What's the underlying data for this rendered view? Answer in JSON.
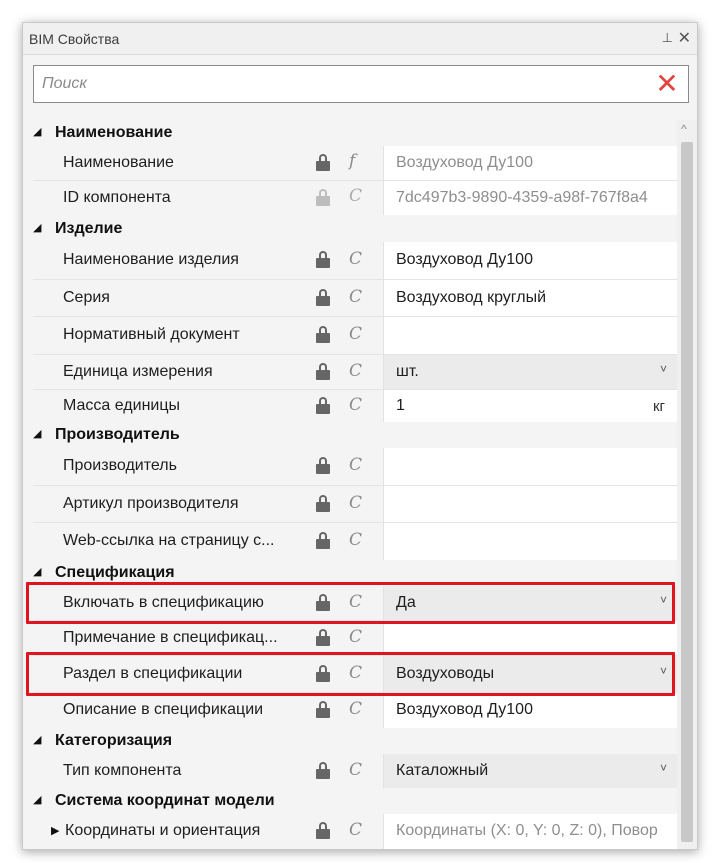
{
  "panel": {
    "title": "BIM Свойства",
    "pin_icon": "pin-icon",
    "close_icon": "close-icon"
  },
  "search": {
    "placeholder": "Поиск",
    "clear_icon": "clear-x-icon",
    "clear_color": "#e0443c"
  },
  "groups": [
    {
      "label": "Наименование"
    },
    {
      "label": "Изделие"
    },
    {
      "label": "Производитель"
    },
    {
      "label": "Спецификация"
    },
    {
      "label": "Категоризация"
    },
    {
      "label": "Система координат модели"
    }
  ],
  "props": {
    "name": {
      "label": "Наименование",
      "value": "Воздуховод Ду100"
    },
    "id": {
      "label": "ID компонента",
      "value": "7dc497b3-9890-4359-a98f-767f8a4"
    },
    "product": {
      "label": "Наименование изделия",
      "value": "Воздуховод Ду100"
    },
    "series": {
      "label": "Серия",
      "value": "Воздуховод круглый"
    },
    "normdoc": {
      "label": "Нормативный документ",
      "value": ""
    },
    "unit": {
      "label": "Единица измерения",
      "value": "шт."
    },
    "mass": {
      "label": "Масса единицы",
      "value": "1",
      "unit": "кг"
    },
    "maker": {
      "label": "Производитель",
      "value": ""
    },
    "article": {
      "label": "Артикул производителя",
      "value": ""
    },
    "weblink": {
      "label": "Web-ссылка на страницу с...",
      "value": ""
    },
    "include": {
      "label": "Включать в спецификацию",
      "value": "Да"
    },
    "note": {
      "label": "Примечание в спецификац...",
      "value": ""
    },
    "section": {
      "label": "Раздел в спецификации",
      "value": "Воздуховоды"
    },
    "descr": {
      "label": "Описание в спецификации",
      "value": "Воздуховод Ду100"
    },
    "ctype": {
      "label": "Тип компонента",
      "value": "Каталожный"
    },
    "coords": {
      "label": "Координаты и ориентация",
      "value": "Координаты (X: 0, Y: 0, Z: 0), Повор"
    }
  },
  "icons": {
    "lock": "lock-icon",
    "formula": "formula-f-icon",
    "constant": "constant-c-icon"
  },
  "symbols": {
    "formula": "f",
    "constant": "C",
    "collapse": "◢",
    "expand": "▶",
    "chevron": "˅",
    "up": "^",
    "clear": "✕",
    "pin": "⊥",
    "close": "✕"
  },
  "colors": {
    "highlight": "#e0141e",
    "panel_bg": "#f4f4f4"
  }
}
